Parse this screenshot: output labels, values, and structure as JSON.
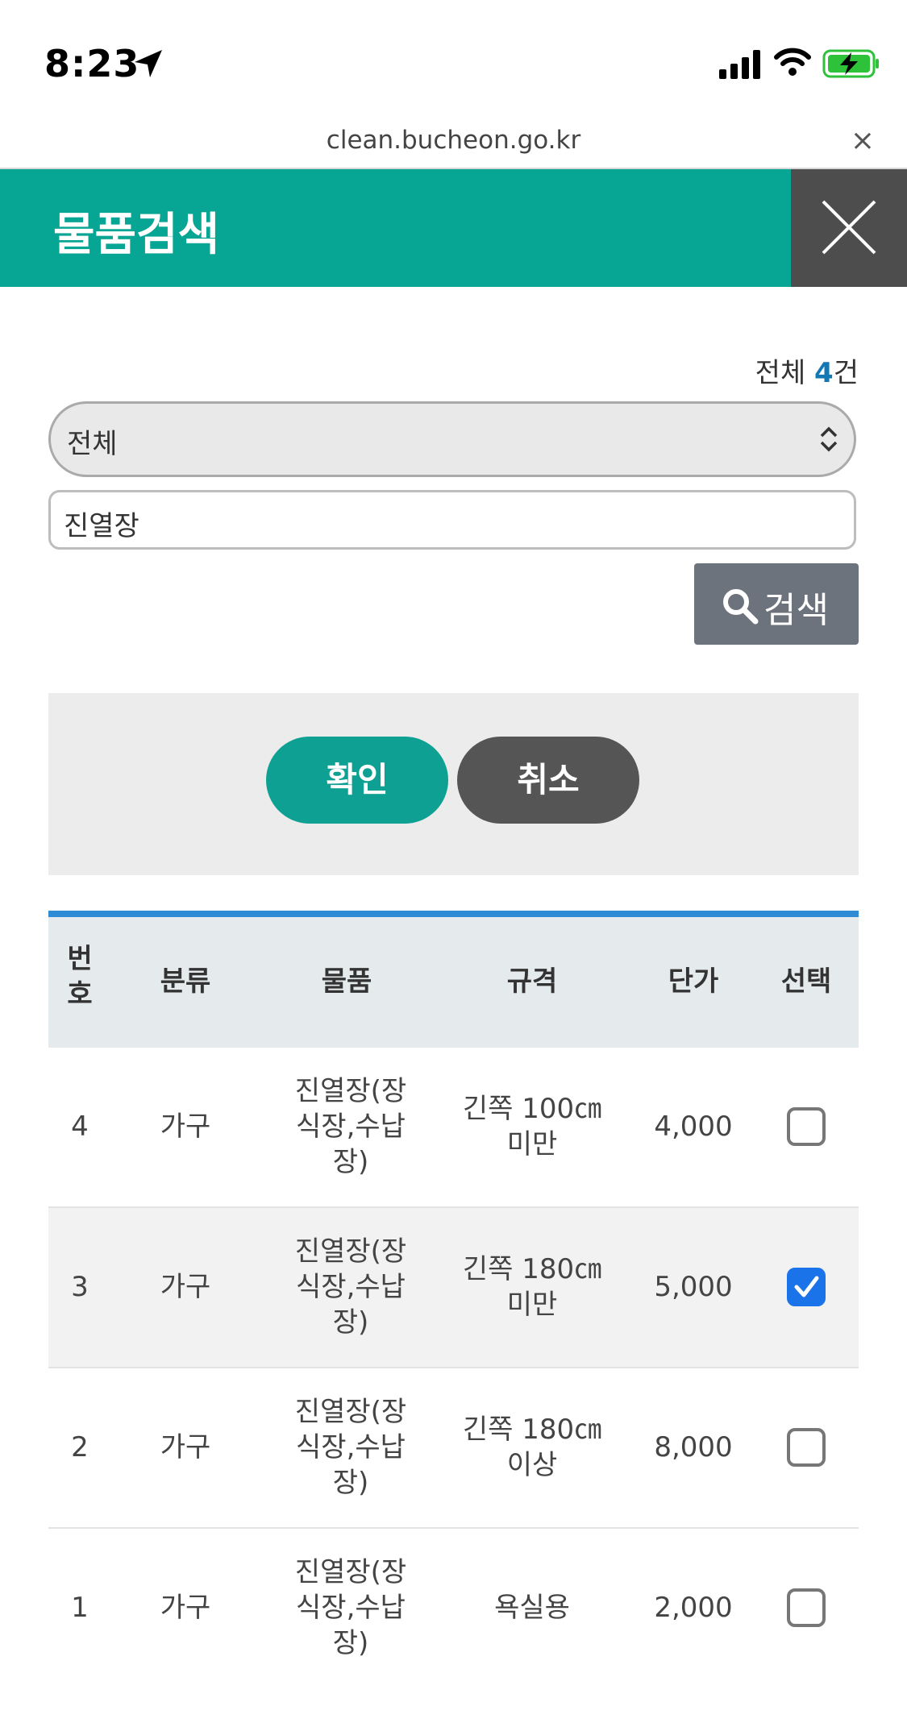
{
  "status": {
    "time": "8:23"
  },
  "browser": {
    "url": "clean.bucheon.go.kr",
    "close": "×"
  },
  "header": {
    "title": "물품검색"
  },
  "count": {
    "prefix": "전체 ",
    "number": "4",
    "suffix": "건"
  },
  "filter": {
    "category_selected": "전체",
    "search_value": "진열장",
    "search_button": "검색"
  },
  "actions": {
    "confirm": "확인",
    "cancel": "취소"
  },
  "table": {
    "headers": [
      "번\n호",
      "분류",
      "물품",
      "규격",
      "단가",
      "선택"
    ],
    "rows": [
      {
        "no": "4",
        "category": "가구",
        "item": "진열장(장\n식장,수납\n장)",
        "spec": "긴쪽 100㎝\n미만",
        "price": "4,000",
        "selected": false
      },
      {
        "no": "3",
        "category": "가구",
        "item": "진열장(장\n식장,수납\n장)",
        "spec": "긴쪽 180㎝\n미만",
        "price": "5,000",
        "selected": true
      },
      {
        "no": "2",
        "category": "가구",
        "item": "진열장(장\n식장,수납\n장)",
        "spec": "긴쪽 180㎝\n이상",
        "price": "8,000",
        "selected": false
      },
      {
        "no": "1",
        "category": "가구",
        "item": "진열장(장\n식장,수납\n장)",
        "spec": "욕실용",
        "price": "2,000",
        "selected": false
      }
    ]
  },
  "colors": {
    "header": "#07a594",
    "accent_blue": "#2e8bd4",
    "checked": "#1a73e8"
  }
}
